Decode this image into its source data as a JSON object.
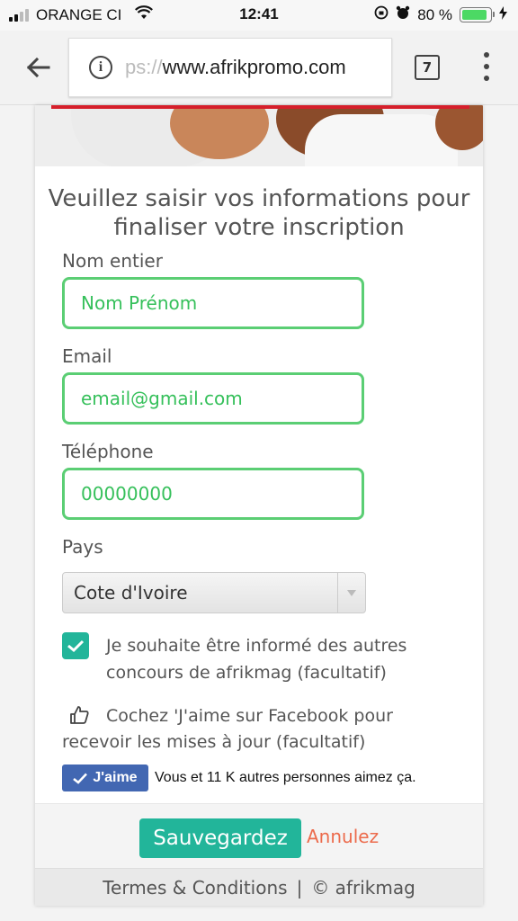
{
  "status_bar": {
    "carrier": "ORANGE CI",
    "time": "12:41",
    "battery_percent": "80 %",
    "battery_level": 0.8
  },
  "browser": {
    "url_scheme": "ps://",
    "url_host": "www.afrikpromo.com",
    "tab_count": "7"
  },
  "form": {
    "heading": "Veuillez saisir vos informations pour finaliser votre inscription",
    "name_label": "Nom entier",
    "name_value": "Nom Prénom",
    "email_label": "Email",
    "email_value": "email@gmail.com",
    "phone_label": "Téléphone",
    "phone_value": "00000000",
    "country_label": "Pays",
    "country_value": "Cote d'Ivoire",
    "newsletter_text": "Je souhaite être informé des autres concours de afrikmag (facultatif)",
    "newsletter_checked": true,
    "like_text": "Cochez 'J'aime sur Facebook pour recevoir les mises à jour (facultatif)",
    "fb_like_label": "J'aime",
    "fb_like_count": "Vous et 11 K autres personnes aimez ça.",
    "save_label": "Sauvegardez",
    "cancel_label": "Annulez"
  },
  "footer": {
    "terms": "Termes & Conditions",
    "separator": "|",
    "copyright": "© afrikmag"
  },
  "colors": {
    "accent_green": "#22b59a",
    "input_border": "#5bce74",
    "cancel": "#ec6b4c",
    "facebook": "#4267b2"
  }
}
